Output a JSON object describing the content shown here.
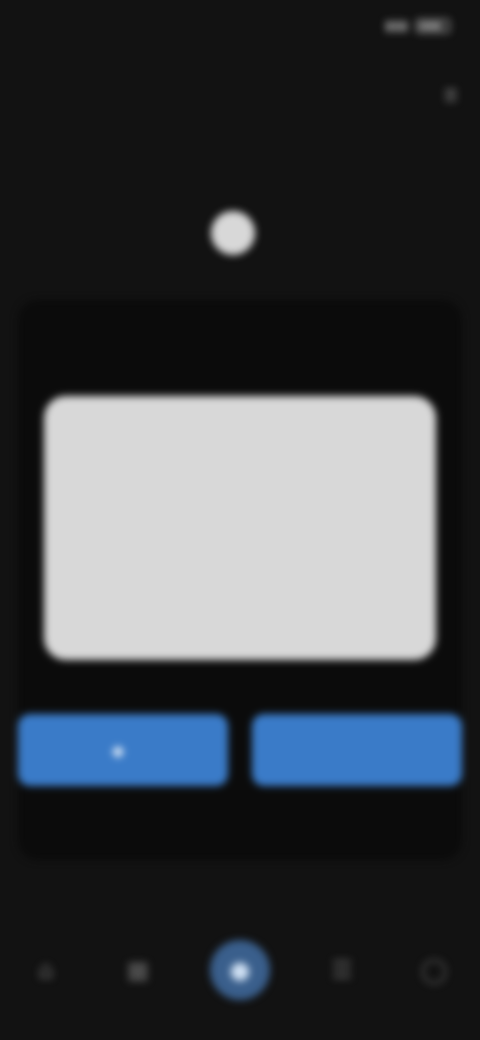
{
  "status_bar": {
    "time": "",
    "battery": ""
  },
  "top_nav": {
    "brand_part1": "",
    "brand_part2": "",
    "menu_label": ""
  },
  "header": {
    "subtitle": "",
    "hero_part1": "",
    "hero_part2": ""
  },
  "dialog": {
    "title": "",
    "message": "",
    "secondary_button": "",
    "primary_button": ""
  },
  "actions": {
    "left_button": "",
    "right_button": ""
  },
  "bottom_nav": {
    "items": [
      {
        "icon": "home-icon",
        "glyph": "⌂"
      },
      {
        "icon": "grid-icon",
        "glyph": "▦"
      },
      {
        "icon": "center-action-icon",
        "glyph": "●"
      },
      {
        "icon": "list-icon",
        "glyph": "☰"
      },
      {
        "icon": "profile-icon",
        "glyph": "◯"
      }
    ]
  },
  "colors": {
    "accent_blue": "#3a7bc8",
    "accent_yellow": "#d8cc3c",
    "dialog_bg": "#d8d8d8",
    "background": "#121212"
  }
}
